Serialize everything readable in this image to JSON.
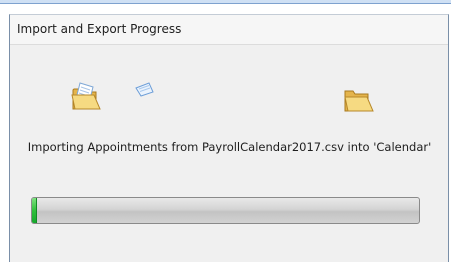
{
  "dialog": {
    "title": "Import and Export Progress",
    "message": "Importing Appointments from PayrollCalendar2017.csv into 'Calendar'",
    "progress_percent": 1
  },
  "icons": {
    "source": "open-folder-with-document-icon",
    "in_transit": "flying-document-icon",
    "destination": "open-folder-icon"
  },
  "colors": {
    "folder": "#f2d27a",
    "progress_fill": "#2fbf3b",
    "progress_track": "#d4d4d4"
  }
}
